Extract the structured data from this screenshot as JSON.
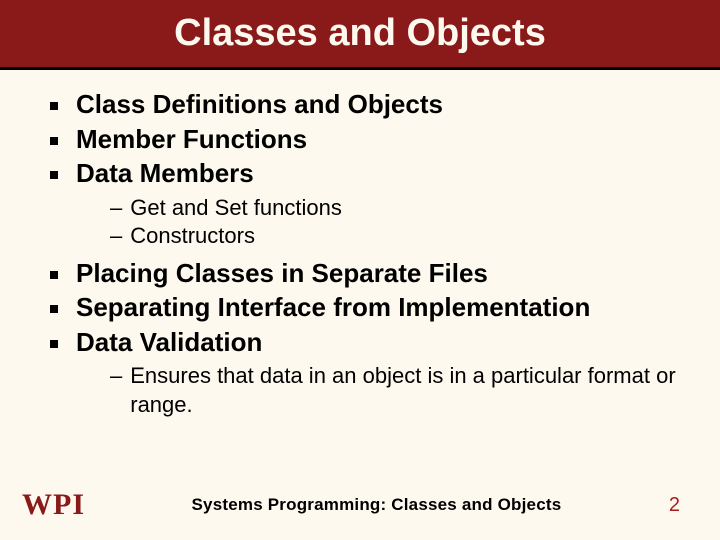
{
  "title": "Classes and Objects",
  "bullets": {
    "b0": "Class Definitions and Objects",
    "b1": "Member Functions",
    "b2": "Data Members",
    "b3": "Placing Classes in Separate Files",
    "b4": "Separating Interface from Implementation",
    "b5": "Data Validation"
  },
  "subs": {
    "s0": "Get and Set functions",
    "s1": "Constructors",
    "s2": "Ensures that data in an object is in a particular format or range."
  },
  "footer": {
    "logo": {
      "w": "W",
      "p": "P",
      "i": "I"
    },
    "text": "Systems Programming: Classes and Objects",
    "page": "2"
  }
}
